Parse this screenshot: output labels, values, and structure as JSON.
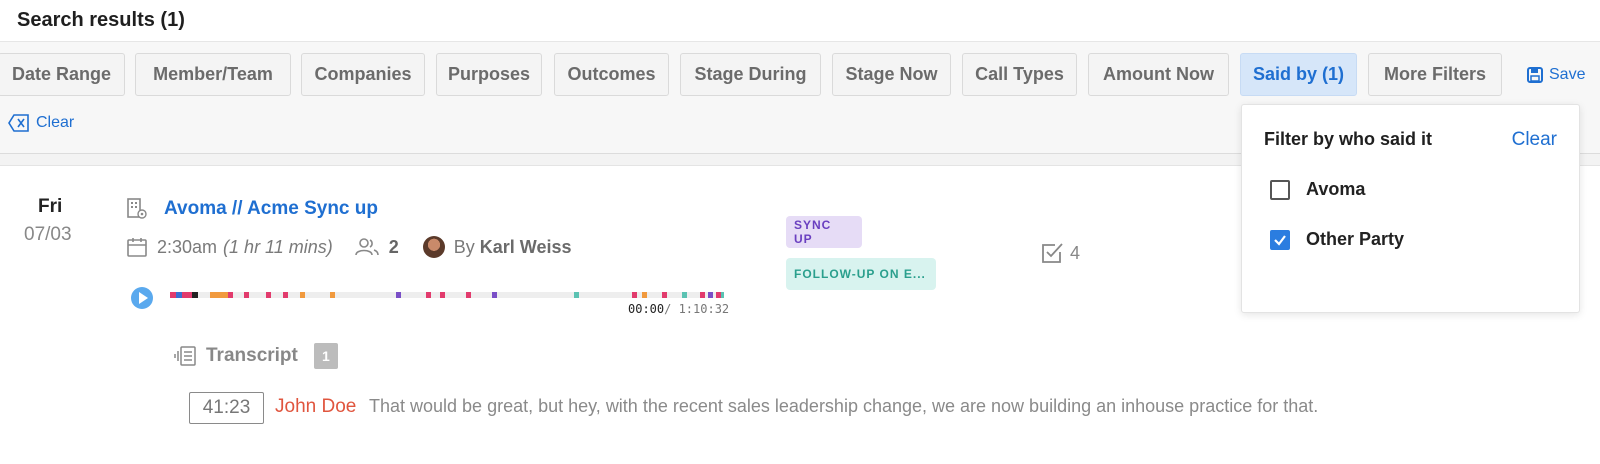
{
  "header": {
    "title": "Search results (1)"
  },
  "filters": {
    "chips": [
      "Date Range",
      "Member/Team",
      "Companies",
      "Purposes",
      "Outcomes",
      "Stage During",
      "Stage Now",
      "Call Types",
      "Amount Now",
      "Said by (1)",
      "More Filters"
    ],
    "active_chip": "Said by (1)",
    "save_label": "Save",
    "clear_label": "Clear"
  },
  "result": {
    "day": "Fri",
    "date": "07/03",
    "title": "Avoma // Acme Sync up",
    "time": "2:30am",
    "duration": "(1 hr 11 mins)",
    "attendees": "2",
    "by_label": "By",
    "owner": "Karl Weiss",
    "player": {
      "current": "00:00",
      "total": "/ 1:10:32"
    },
    "tags": [
      "SYNC UP",
      "FOLLOW-UP ON E..."
    ],
    "tasks_count": "4",
    "transcript": {
      "label": "Transcript",
      "count": "1",
      "timestamp": "41:23",
      "speaker": "John Doe",
      "text": "That would be great, but hey, with the recent sales leadership change, we are now building an inhouse practice for that."
    }
  },
  "popover": {
    "title": "Filter by who said it",
    "clear_label": "Clear",
    "options": [
      {
        "label": "Avoma",
        "checked": false
      },
      {
        "label": "Other Party",
        "checked": true
      }
    ]
  },
  "colors": {
    "accent": "#1f6fd1",
    "speaker": "#e0553e",
    "tag_purple": "#6a3fc0",
    "tag_teal": "#2a9f8d"
  }
}
